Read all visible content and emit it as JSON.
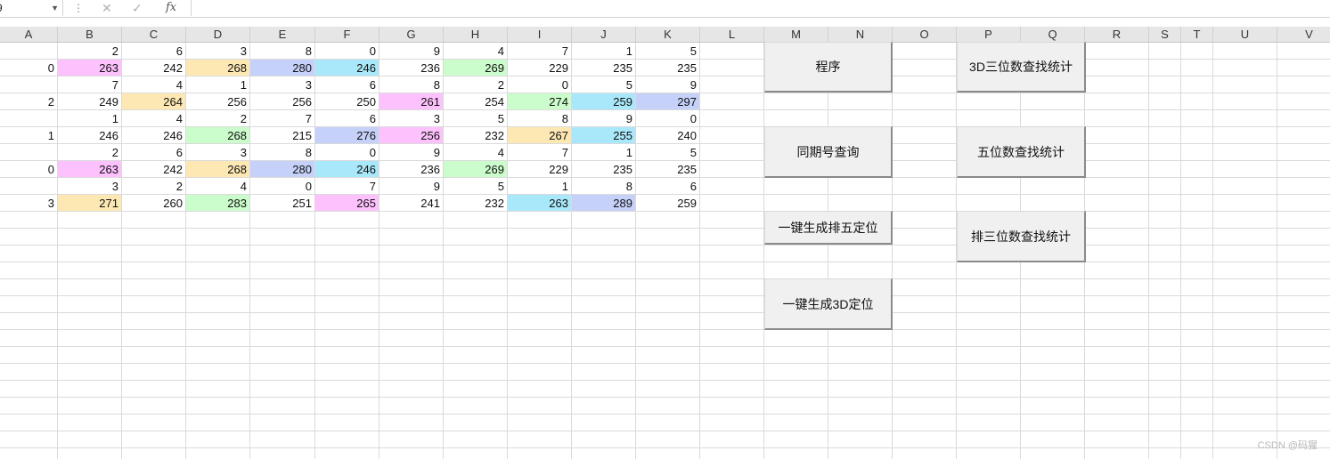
{
  "formula_bar": {
    "name_box": "9",
    "fx_label": "fx",
    "cancel_icon": "✕",
    "confirm_icon": "✓",
    "dots": "⋮",
    "formula": ""
  },
  "columns": [
    "A",
    "B",
    "C",
    "D",
    "E",
    "F",
    "G",
    "H",
    "I",
    "J",
    "K",
    "L",
    "M",
    "N",
    "O",
    "P",
    "Q",
    "R",
    "S",
    "T",
    "U",
    "V"
  ],
  "colors": {
    "pink": "#fdc1fd",
    "yellow": "#fde8b4",
    "blue": "#c6d1fa",
    "cyan": "#a9e8fa",
    "green": "#cbfccb"
  },
  "rows": [
    {
      "a": "",
      "cells": [
        {
          "v": "2"
        },
        {
          "v": "6"
        },
        {
          "v": "3"
        },
        {
          "v": "8"
        },
        {
          "v": "0"
        },
        {
          "v": "9"
        },
        {
          "v": "4"
        },
        {
          "v": "7"
        },
        {
          "v": "1"
        },
        {
          "v": "5"
        }
      ]
    },
    {
      "a": "0",
      "cells": [
        {
          "v": "263",
          "c": "pink"
        },
        {
          "v": "242"
        },
        {
          "v": "268",
          "c": "yellow"
        },
        {
          "v": "280",
          "c": "blue"
        },
        {
          "v": "246",
          "c": "cyan"
        },
        {
          "v": "236"
        },
        {
          "v": "269",
          "c": "green"
        },
        {
          "v": "229"
        },
        {
          "v": "235"
        },
        {
          "v": "235"
        }
      ]
    },
    {
      "a": "",
      "cells": [
        {
          "v": "7"
        },
        {
          "v": "4"
        },
        {
          "v": "1"
        },
        {
          "v": "3"
        },
        {
          "v": "6"
        },
        {
          "v": "8"
        },
        {
          "v": "2"
        },
        {
          "v": "0"
        },
        {
          "v": "5"
        },
        {
          "v": "9"
        }
      ]
    },
    {
      "a": "2",
      "cells": [
        {
          "v": "249"
        },
        {
          "v": "264",
          "c": "yellow"
        },
        {
          "v": "256"
        },
        {
          "v": "256"
        },
        {
          "v": "250"
        },
        {
          "v": "261",
          "c": "pink"
        },
        {
          "v": "254"
        },
        {
          "v": "274",
          "c": "green"
        },
        {
          "v": "259",
          "c": "cyan"
        },
        {
          "v": "297",
          "c": "blue"
        }
      ]
    },
    {
      "a": "",
      "cells": [
        {
          "v": "1"
        },
        {
          "v": "4"
        },
        {
          "v": "2"
        },
        {
          "v": "7"
        },
        {
          "v": "6"
        },
        {
          "v": "3"
        },
        {
          "v": "5"
        },
        {
          "v": "8"
        },
        {
          "v": "9"
        },
        {
          "v": "0"
        }
      ]
    },
    {
      "a": "1",
      "cells": [
        {
          "v": "246"
        },
        {
          "v": "246"
        },
        {
          "v": "268",
          "c": "green"
        },
        {
          "v": "215"
        },
        {
          "v": "276",
          "c": "blue"
        },
        {
          "v": "256",
          "c": "pink"
        },
        {
          "v": "232"
        },
        {
          "v": "267",
          "c": "yellow"
        },
        {
          "v": "255",
          "c": "cyan"
        },
        {
          "v": "240"
        }
      ]
    },
    {
      "a": "",
      "cells": [
        {
          "v": "2"
        },
        {
          "v": "6"
        },
        {
          "v": "3"
        },
        {
          "v": "8"
        },
        {
          "v": "0"
        },
        {
          "v": "9"
        },
        {
          "v": "4"
        },
        {
          "v": "7"
        },
        {
          "v": "1"
        },
        {
          "v": "5"
        }
      ]
    },
    {
      "a": "0",
      "cells": [
        {
          "v": "263",
          "c": "pink"
        },
        {
          "v": "242"
        },
        {
          "v": "268",
          "c": "yellow"
        },
        {
          "v": "280",
          "c": "blue"
        },
        {
          "v": "246",
          "c": "cyan"
        },
        {
          "v": "236"
        },
        {
          "v": "269",
          "c": "green"
        },
        {
          "v": "229"
        },
        {
          "v": "235"
        },
        {
          "v": "235"
        }
      ]
    },
    {
      "a": "",
      "cells": [
        {
          "v": "3"
        },
        {
          "v": "2"
        },
        {
          "v": "4"
        },
        {
          "v": "0"
        },
        {
          "v": "7"
        },
        {
          "v": "9"
        },
        {
          "v": "5"
        },
        {
          "v": "1"
        },
        {
          "v": "8"
        },
        {
          "v": "6"
        }
      ]
    },
    {
      "a": "3",
      "cells": [
        {
          "v": "271",
          "c": "yellow"
        },
        {
          "v": "260"
        },
        {
          "v": "283",
          "c": "green"
        },
        {
          "v": "251"
        },
        {
          "v": "265",
          "c": "pink"
        },
        {
          "v": "241"
        },
        {
          "v": "232"
        },
        {
          "v": "263",
          "c": "cyan"
        },
        {
          "v": "289",
          "c": "blue"
        },
        {
          "v": "259"
        }
      ]
    }
  ],
  "buttons": {
    "sort": "程序",
    "3d_three_digit": "3D三位数查找统计",
    "same_period": "同期号查询",
    "five_digit": "五位数查找统计",
    "gen_p5": "一键生成排五定位",
    "p3_three_digit": "排三位数查找统计",
    "gen_3d": "一键生成3D定位"
  },
  "watermark": "CSDN @码猩"
}
